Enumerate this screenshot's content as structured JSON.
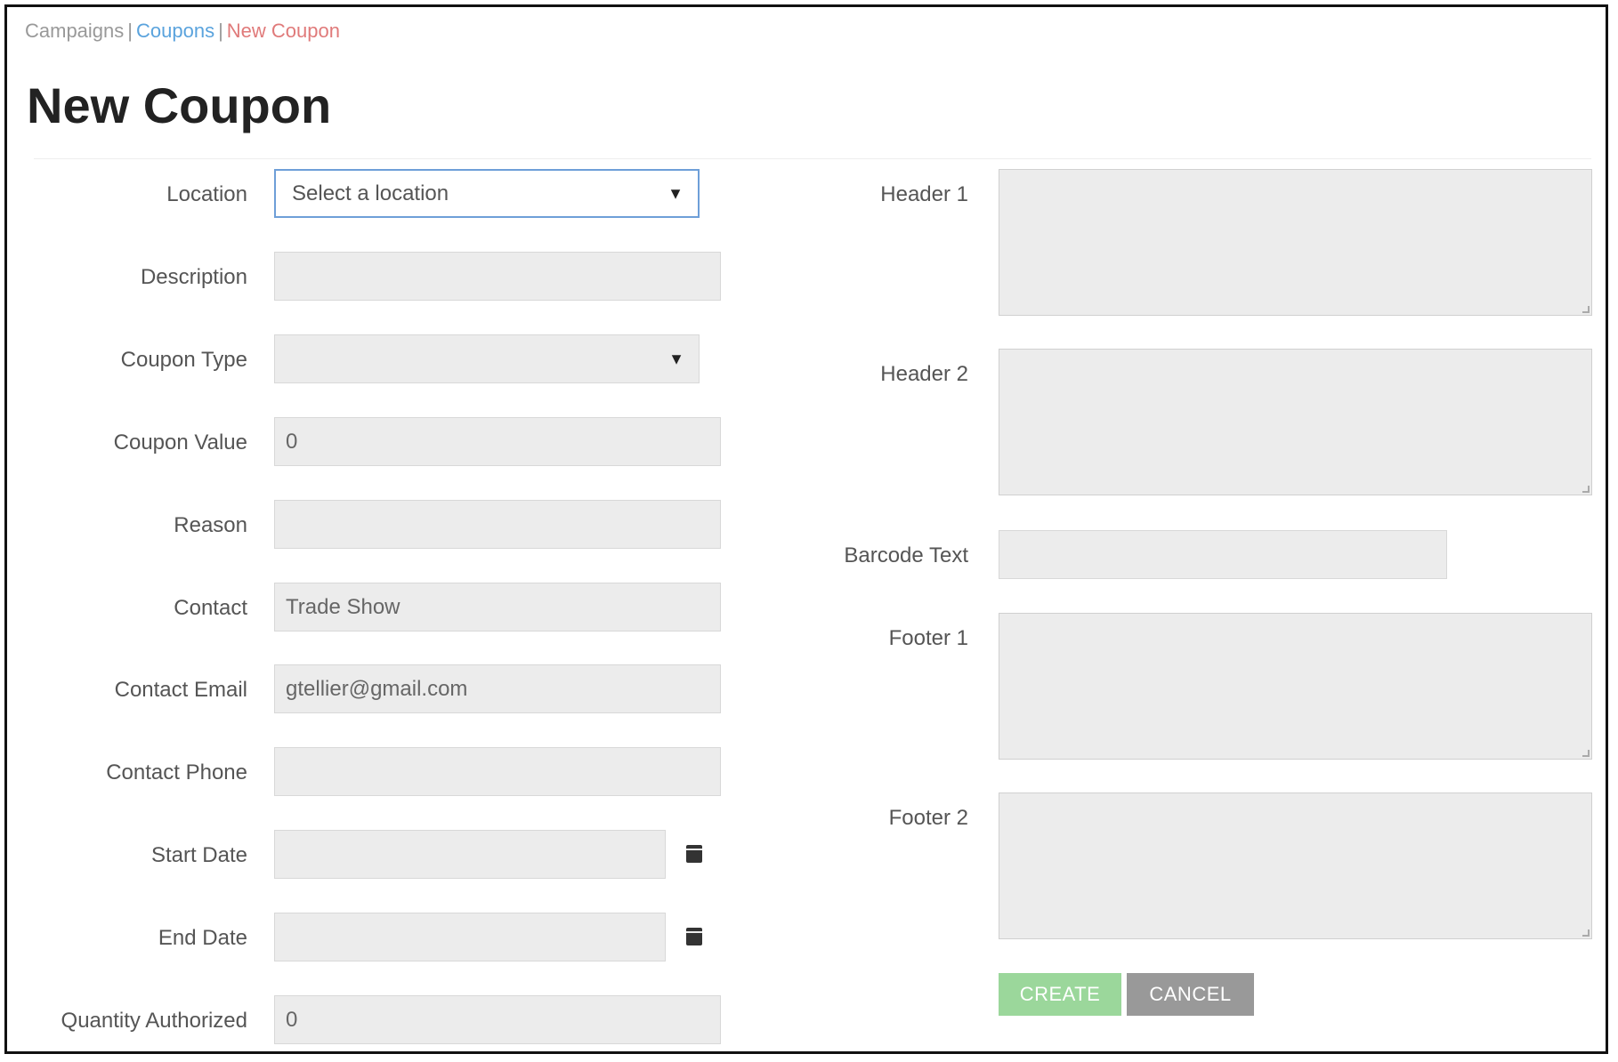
{
  "breadcrumb": {
    "items": [
      "Campaigns",
      "Coupons",
      "New Coupon"
    ],
    "separator": "|"
  },
  "page": {
    "title": "New Coupon"
  },
  "form": {
    "location": {
      "label": "Location",
      "value": "Select a location"
    },
    "description": {
      "label": "Description",
      "value": ""
    },
    "coupon_type": {
      "label": "Coupon Type",
      "value": ""
    },
    "coupon_value": {
      "label": "Coupon Value",
      "value": "0"
    },
    "reason": {
      "label": "Reason",
      "value": ""
    },
    "contact": {
      "label": "Contact",
      "value": "Trade Show"
    },
    "contact_email": {
      "label": "Contact Email",
      "value": "gtellier@gmail.com"
    },
    "contact_phone": {
      "label": "Contact Phone",
      "value": ""
    },
    "start_date": {
      "label": "Start Date",
      "value": ""
    },
    "end_date": {
      "label": "End Date",
      "value": ""
    },
    "quantity_authorized": {
      "label": "Quantity Authorized",
      "value": "0"
    },
    "header_1": {
      "label": "Header 1"
    },
    "header_2": {
      "label": "Header 2"
    },
    "barcode_text": {
      "label": "Barcode Text",
      "value": ""
    },
    "footer_1": {
      "label": "Footer 1"
    },
    "footer_2": {
      "label": "Footer 2"
    }
  },
  "actions": {
    "create_label": "CREATE",
    "cancel_label": "CANCEL"
  },
  "icons": {
    "dropdown": "chevron-down-icon",
    "date_picker": "calendar-icon"
  },
  "colors": {
    "link": "#5aa3dd",
    "current_breadcrumb": "#e07a7a",
    "create_button": "#9bd79b",
    "cancel_button": "#999999",
    "focus_border": "#6e9fd8"
  }
}
